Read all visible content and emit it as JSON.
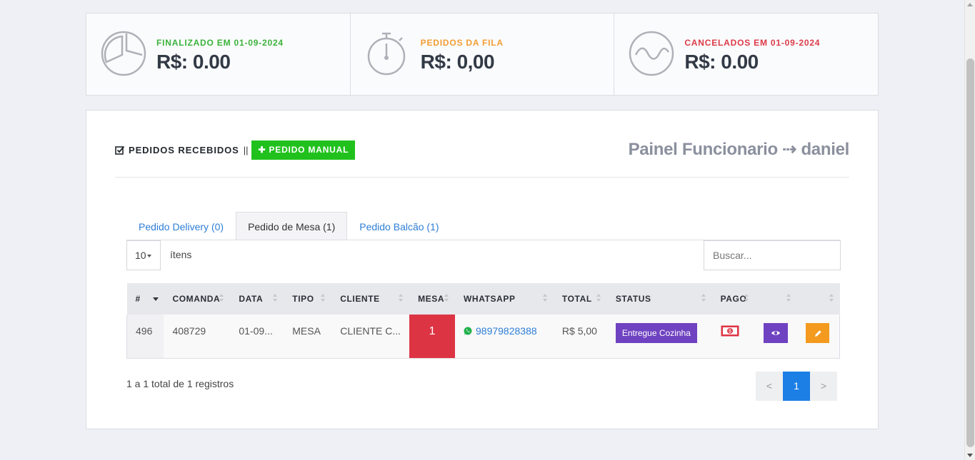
{
  "stats": [
    {
      "label": "FINALIZADO EM 01-09-2024",
      "value": "R$: 0.00",
      "color": "#3bb33b",
      "icon": "pie-chart-icon"
    },
    {
      "label": "PEDIDOS DA FILA",
      "value": "R$: 0,00",
      "color": "#f39c34",
      "icon": "stopwatch-icon"
    },
    {
      "label": "CANCELADOS EM 01-09-2024",
      "value": "R$: 0.00",
      "color": "#dd3a48",
      "icon": "wave-icon"
    }
  ],
  "header": {
    "title": "PEDIDOS RECEBIDOS",
    "separator": "||",
    "manual_button": "PEDIDO MANUAL",
    "panel_title": "Painel Funcionario ⇢ daniel"
  },
  "tabs": [
    {
      "label": "Pedido Delivery (0)"
    },
    {
      "label": "Pedido de Mesa (1)"
    },
    {
      "label": "Pedido Balcão (1)"
    }
  ],
  "controls": {
    "page_length": "10",
    "page_length_label": "ítens",
    "search_placeholder": "Buscar..."
  },
  "table": {
    "columns": [
      "#",
      "COMANDA",
      "DATA",
      "TIPO",
      "CLIENTE",
      "MESA",
      "WHATSAPP",
      "TOTAL",
      "STATUS",
      "PAGO",
      "",
      ""
    ],
    "rows": [
      {
        "id": "496",
        "comanda": "408729",
        "data": "01-09...",
        "tipo": "MESA",
        "cliente": "CLIENTE C...",
        "mesa": "1",
        "whatsapp": "98979828388",
        "total": "R$ 5,00",
        "status": "Entregue Cozinha"
      }
    ]
  },
  "footer": {
    "info": "1 a 1 total de 1 registros",
    "prev": "<",
    "current": "1",
    "next": ">"
  }
}
